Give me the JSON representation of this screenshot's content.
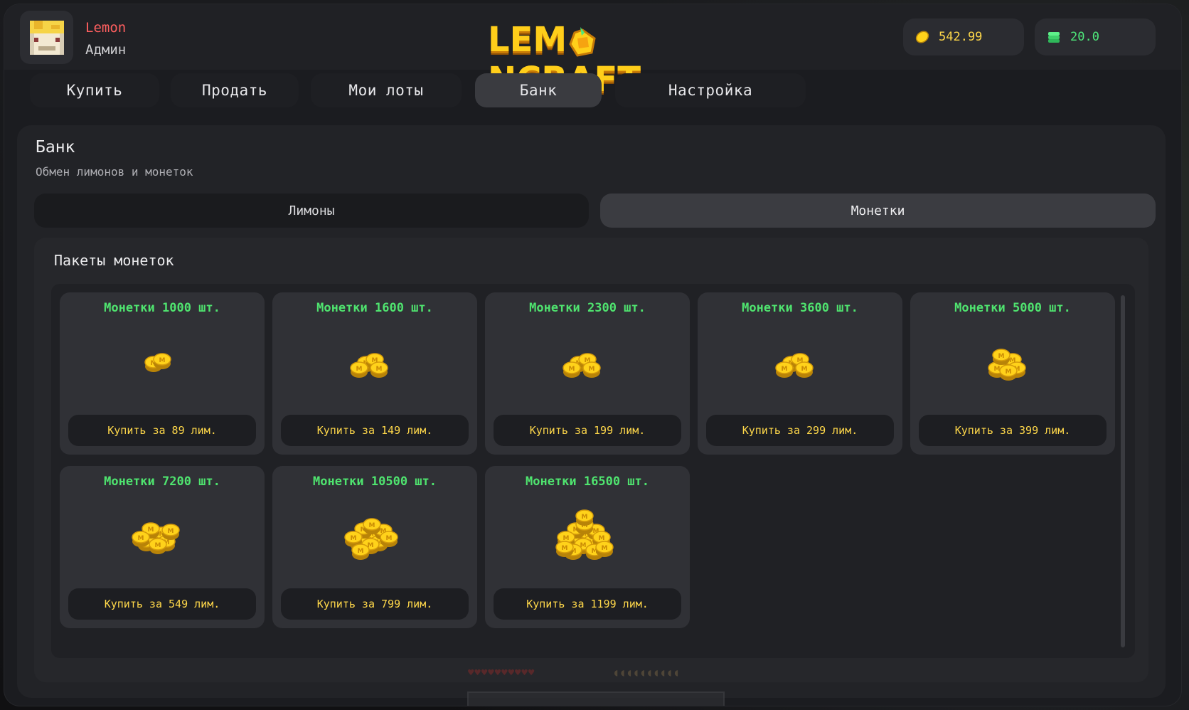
{
  "header": {
    "username": "Lemon",
    "role": "Админ",
    "logo_text_left": "LEM",
    "logo_text_right": "NCRAFT",
    "balances": {
      "lemons": {
        "value": "542.99",
        "icon": "lemon-icon",
        "color": "#ffd84a"
      },
      "coins": {
        "value": "20.0",
        "icon": "coin-stack-icon",
        "color": "#4ee87a"
      }
    }
  },
  "nav": {
    "tabs": [
      {
        "label": "Купить",
        "active": false
      },
      {
        "label": "Продать",
        "active": false
      },
      {
        "label": "Мои лоты",
        "active": false
      },
      {
        "label": "Банк",
        "active": true
      },
      {
        "label": "Настройка",
        "active": false
      }
    ]
  },
  "panel": {
    "title": "Банк",
    "subtitle": "Обмен лимонов и монеток",
    "segments": [
      {
        "label": "Лимоны",
        "active": false
      },
      {
        "label": "Монетки",
        "active": true
      }
    ],
    "section_title": "Пакеты монеток"
  },
  "packages": [
    {
      "title": "Монетки 1000 шт.",
      "buy": "Купить за 89 лим.",
      "icon": "coin-pile-small-icon"
    },
    {
      "title": "Монетки 1600 шт.",
      "buy": "Купить за 149 лим.",
      "icon": "coin-pile-icon"
    },
    {
      "title": "Монетки 2300 шт.",
      "buy": "Купить за 199 лим.",
      "icon": "coin-pile-icon"
    },
    {
      "title": "Монетки 3600 шт.",
      "buy": "Купить за 299 лим.",
      "icon": "coin-pile-icon"
    },
    {
      "title": "Монетки 5000 шт.",
      "buy": "Купить за 399 лим.",
      "icon": "coin-stack-icon"
    },
    {
      "title": "Монетки 7200 шт.",
      "buy": "Купить за 549 лим.",
      "icon": "coin-stack-icon"
    },
    {
      "title": "Монетки 10500 шт.",
      "buy": "Купить за 799 лим.",
      "icon": "coin-stack-large-icon"
    },
    {
      "title": "Монетки 16500 шт.",
      "buy": "Купить за 1199 лим.",
      "icon": "coin-stack-large-icon"
    }
  ],
  "colors": {
    "package_title": "#4fe46f",
    "buy_text": "#ffd84a",
    "username": "#ff5f5f",
    "logo": "#ffce1a"
  }
}
